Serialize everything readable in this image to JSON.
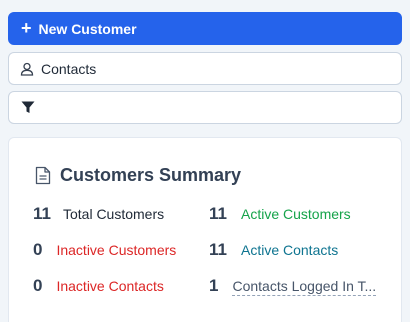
{
  "actions": {
    "new_customer_label": "New Customer",
    "contacts_label": "Contacts"
  },
  "summary": {
    "title": "Customers Summary",
    "stats": [
      {
        "value": "11",
        "label": "Total Customers"
      },
      {
        "value": "11",
        "label": "Active Customers"
      },
      {
        "value": "0",
        "label": "Inactive Customers"
      },
      {
        "value": "11",
        "label": "Active Contacts"
      },
      {
        "value": "0",
        "label": "Inactive Contacts"
      },
      {
        "value": "1",
        "label": "Contacts Logged In T..."
      }
    ]
  },
  "icons": {
    "new": "plus-icon",
    "contacts": "user-icon",
    "filter": "filter-icon",
    "summary": "document-icon"
  },
  "colors": {
    "primary": "#2563eb",
    "active": "#16a34a",
    "inactive": "#dc2626",
    "contacts": "#0e7490"
  }
}
